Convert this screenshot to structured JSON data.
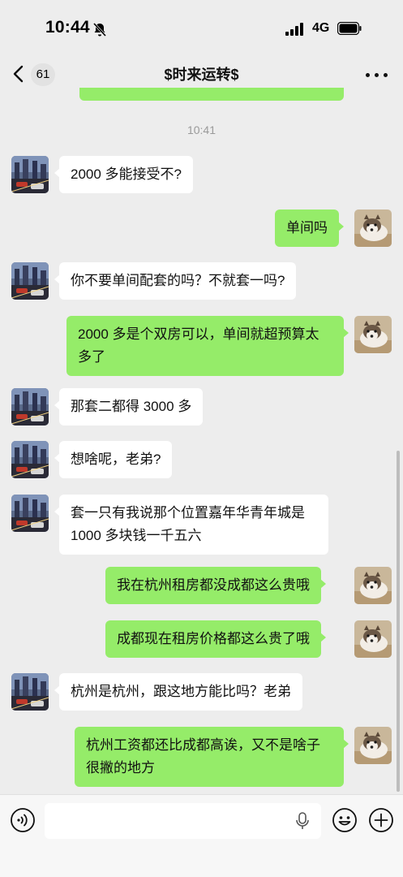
{
  "status": {
    "time": "10:44",
    "network": "4G",
    "icons": [
      "bell-off-icon",
      "signal-bars-icon",
      "battery-icon"
    ]
  },
  "nav": {
    "back_icon": "chevron-left-icon",
    "unread_count": "61",
    "title": "$时来运转$",
    "more_icon": "more-dots-icon"
  },
  "chat": {
    "timestamp": "10:41",
    "messages": [
      {
        "side": "in",
        "text": "2000 多能接受不?"
      },
      {
        "side": "out",
        "text": "单间吗"
      },
      {
        "side": "in",
        "text": "你不要单间配套的吗？不就套一吗?"
      },
      {
        "side": "out",
        "text": "2000 多是个双房可以，单间就超预算太多了"
      },
      {
        "side": "in",
        "text": "那套二都得 3000 多"
      },
      {
        "side": "in",
        "text": "想啥呢，老弟?"
      },
      {
        "side": "in",
        "text": "套一只有我说那个位置嘉年华青年城是 1000 多块钱一千五六"
      },
      {
        "side": "out",
        "text": "我在杭州租房都没成都这么贵哦"
      },
      {
        "side": "out",
        "text": "成都现在租房价格都这么贵了哦"
      },
      {
        "side": "in",
        "text": "杭州是杭州，跟这地方能比吗？老弟"
      },
      {
        "side": "out",
        "text": "杭州工资都还比成都高诶，又不是啥子很撇的地方"
      }
    ]
  },
  "input_bar": {
    "voice_icon": "voice-icon",
    "mic_icon": "mic-icon",
    "emoji_icon": "emoji-icon",
    "plus_icon": "plus-icon"
  }
}
